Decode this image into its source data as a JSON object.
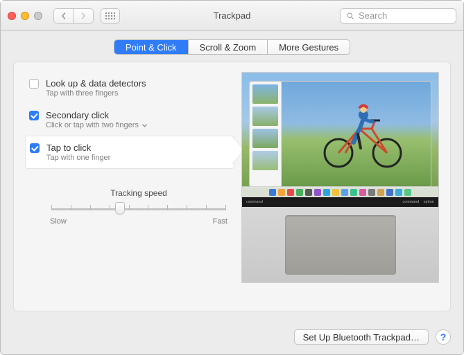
{
  "window": {
    "title": "Trackpad"
  },
  "search": {
    "placeholder": "Search"
  },
  "tabs": [
    {
      "label": "Point & Click",
      "active": true
    },
    {
      "label": "Scroll & Zoom",
      "active": false
    },
    {
      "label": "More Gestures",
      "active": false
    }
  ],
  "options": {
    "lookup": {
      "title": "Look up & data detectors",
      "sub": "Tap with three fingers",
      "checked": false
    },
    "secondary": {
      "title": "Secondary click",
      "sub": "Click or tap with two fingers",
      "checked": true,
      "has_menu": true
    },
    "tapclick": {
      "title": "Tap to click",
      "sub": "Tap with one finger",
      "checked": true,
      "selected": true
    }
  },
  "tracking": {
    "title": "Tracking speed",
    "slow": "Slow",
    "fast": "Fast",
    "ticks": 10,
    "value": 4
  },
  "keyboard_labels": {
    "left": "command",
    "right_cmd": "command",
    "right_opt": "option"
  },
  "dock_colors": [
    "#3a7bd5",
    "#f2a33c",
    "#e24c4c",
    "#47b05b",
    "#5a5a5a",
    "#9153d1",
    "#2aa7d8",
    "#f0c23c",
    "#5ea0e6",
    "#3cc18e",
    "#d85aa1",
    "#7a7a7a",
    "#cfa24e",
    "#4571c6",
    "#3aaed8",
    "#57c785"
  ],
  "footer": {
    "bt_button": "Set Up Bluetooth Trackpad…"
  },
  "icons": {
    "back": "chevron-left-icon",
    "forward": "chevron-right-icon",
    "apps": "grid-icon",
    "search": "search-icon",
    "dropdown": "chevron-down-icon",
    "help": "help-icon"
  }
}
